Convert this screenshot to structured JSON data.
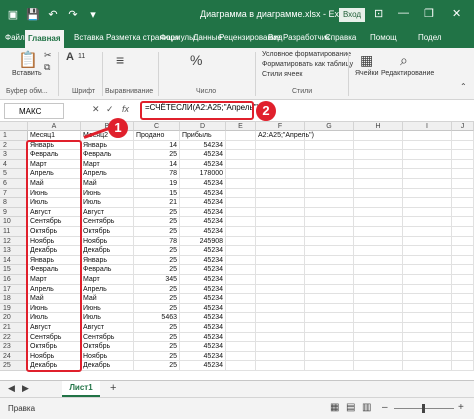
{
  "titlebar": {
    "autosave_icon": "autosave-icon",
    "title": "Диаграмма в диаграмме.xlsx - Excel",
    "login": "Вход",
    "minimize": "—",
    "restore": "❐",
    "close": "✕"
  },
  "tabs": [
    "Файл",
    "Главная",
    "Вставка",
    "Разметка страницы",
    "Формулы",
    "Данные",
    "Рецензирование",
    "Вид",
    "Разработчик",
    "Справка",
    "Помощ",
    "Подел"
  ],
  "ribbon": {
    "paste_label": "Вставить",
    "clipboard_label": "Буфер обм...",
    "font_label": "Шрифт",
    "font_size": "11",
    "align_label": "Выравнивание",
    "number_label": "Число",
    "percent": "%",
    "styles": [
      "Условное форматирование",
      "Форматировать как таблицу",
      "Стили ячеек"
    ],
    "styles_label": "Стили",
    "cells_btn": "Ячейки",
    "edit_btn": "Редактирование"
  },
  "formula_bar": {
    "name_box": "МАКС",
    "cancel": "✕",
    "enter": "✓",
    "fx": "fx",
    "formula": "=СЧЁТЕСЛИ(A2:A25;\"Апрель\")"
  },
  "columns": [
    "A",
    "B",
    "C",
    "D",
    "E",
    "F",
    "G",
    "H",
    "I",
    "J",
    "K"
  ],
  "rows": [
    [
      "Месяц1",
      "Месяц2",
      "Продано",
      "Прибыль"
    ],
    [
      "Январь",
      "Январь",
      "14",
      "54234"
    ],
    [
      "Февраль",
      "Февраль",
      "25",
      "45234"
    ],
    [
      "Март",
      "Март",
      "14",
      "45234"
    ],
    [
      "Апрель",
      "Апрель",
      "78",
      "178000"
    ],
    [
      "Май",
      "Май",
      "19",
      "45234"
    ],
    [
      "Июнь",
      "Июнь",
      "15",
      "45234"
    ],
    [
      "Июль",
      "Июль",
      "21",
      "45234"
    ],
    [
      "Август",
      "Август",
      "25",
      "45234"
    ],
    [
      "Сентябрь",
      "Сентябрь",
      "25",
      "45234"
    ],
    [
      "Октябрь",
      "Октябрь",
      "25",
      "45234"
    ],
    [
      "Ноябрь",
      "Ноябрь",
      "78",
      "245908"
    ],
    [
      "Декабрь",
      "Декабрь",
      "25",
      "45234"
    ],
    [
      "Январь",
      "Январь",
      "25",
      "45234"
    ],
    [
      "Февраль",
      "Февраль",
      "25",
      "45234"
    ],
    [
      "Март",
      "Март",
      "345",
      "45234"
    ],
    [
      "Апрель",
      "Апрель",
      "25",
      "45234"
    ],
    [
      "Май",
      "Май",
      "25",
      "45234"
    ],
    [
      "Июнь",
      "Июнь",
      "25",
      "45234"
    ],
    [
      "Июль",
      "Июль",
      "5463",
      "45234"
    ],
    [
      "Август",
      "Август",
      "25",
      "45234"
    ],
    [
      "Сентябрь",
      "Сентябрь",
      "25",
      "45234"
    ],
    [
      "Октябрь",
      "Октябрь",
      "25",
      "45234"
    ],
    [
      "Ноябрь",
      "Ноябрь",
      "25",
      "45234"
    ],
    [
      "Декабрь",
      "Декабрь",
      "25",
      "45234"
    ]
  ],
  "f1_text": "A2:A25;\"Апрель\")",
  "badges": [
    "1",
    "2"
  ],
  "sheet_tab": "Лист1",
  "add_sheet": "+",
  "status": {
    "mode": "Правка",
    "zoom_minus": "–",
    "zoom_plus": "+"
  }
}
